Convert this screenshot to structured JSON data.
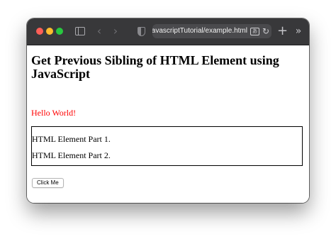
{
  "browser": {
    "url": "javascriptTutorial/example.html",
    "icons": {
      "back": "‹",
      "forward": "›",
      "reload": "↻",
      "new_tab": "+",
      "overflow": "»",
      "translate": "あ"
    },
    "colors": {
      "close": "#fe5f57",
      "minimize": "#febc2e",
      "maximize": "#28c840",
      "titlebar": "#38383a"
    }
  },
  "page": {
    "heading": "Get Previous Sibling of HTML Element using JavaScript",
    "hello": "Hello World!",
    "hello_color": "#ff0000",
    "parts": [
      "HTML Element Part 1.",
      "HTML Element Part 2."
    ],
    "button_label": "Click Me"
  }
}
